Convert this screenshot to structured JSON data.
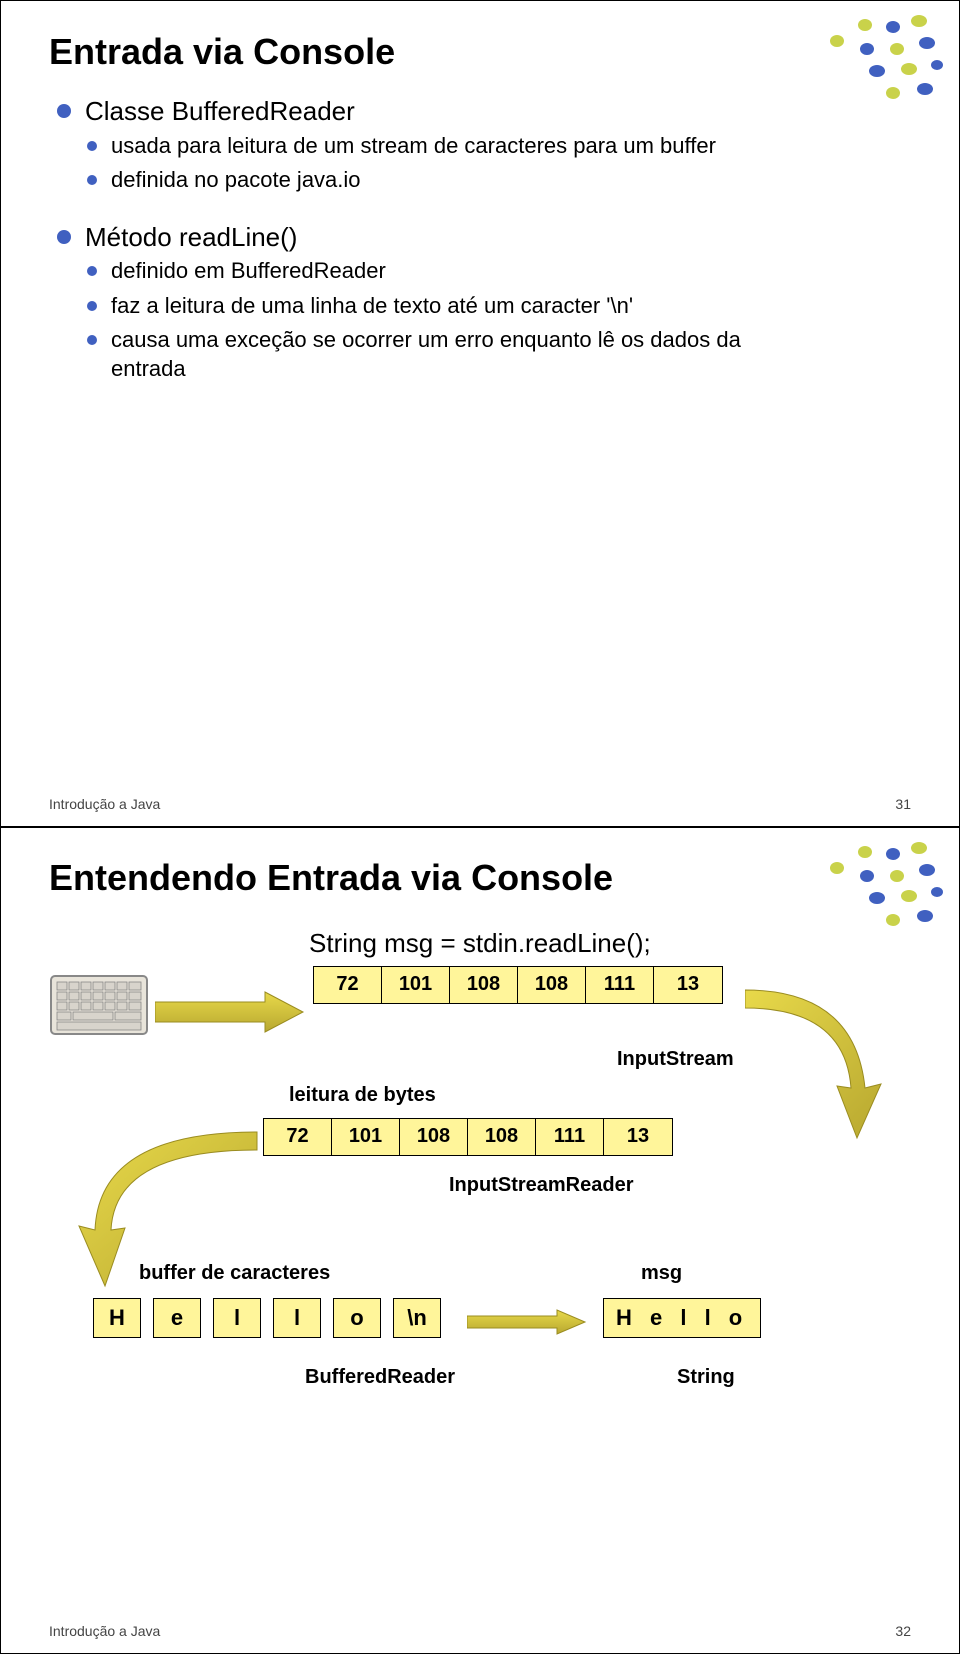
{
  "slide1": {
    "title": "Entrada via Console",
    "item1": "Classe BufferedReader",
    "item1a": "usada para leitura de um stream de caracteres para um buffer",
    "item1b": "definida no pacote java.io",
    "item2": "Método readLine()",
    "item2a": "definido em BufferedReader",
    "item2b": "faz a leitura de uma linha de texto até um caracter '\\n'",
    "item2c": "causa uma exceção se ocorrer um erro enquanto lê os dados da entrada",
    "footer": "Introdução a Java",
    "pagenum": "31"
  },
  "slide2": {
    "title": "Entendendo Entrada via Console",
    "code": "String msg = stdin.readLine();",
    "bytes": [
      "72",
      "101",
      "108",
      "108",
      "111",
      "13"
    ],
    "label_leitura": "leitura de bytes",
    "label_inputstream": "InputStream",
    "label_inputstreamreader": "InputStreamReader",
    "label_bufferchars": "buffer de caracteres",
    "chars": [
      "H",
      "e",
      "l",
      "l",
      "o",
      "\\n"
    ],
    "label_bufferedreader": "BufferedReader",
    "label_msg": "msg",
    "msg_value": "H e l l o",
    "label_string": "String",
    "footer": "Introdução a Java",
    "pagenum": "32"
  }
}
